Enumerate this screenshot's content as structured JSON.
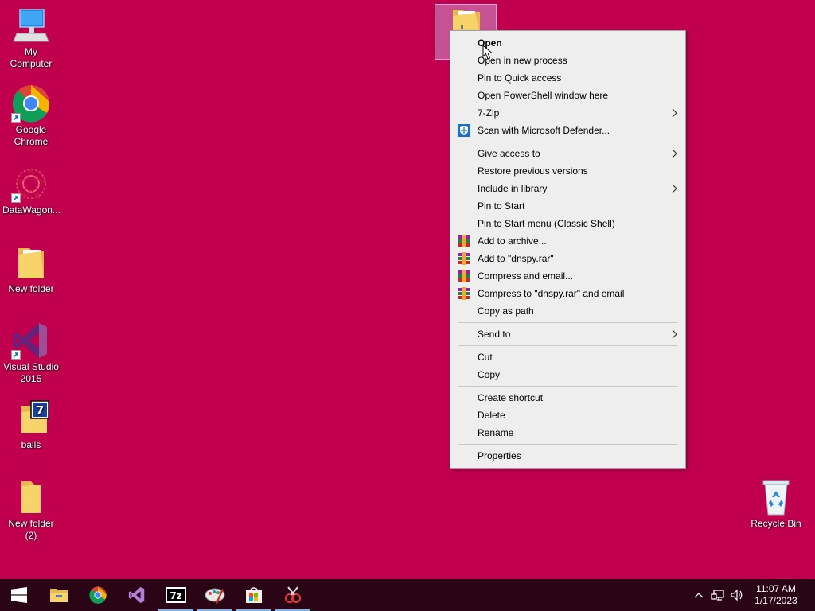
{
  "desktop": {
    "background": "#c0004f",
    "icons": [
      {
        "label": "My Computer",
        "icon": "computer-icon"
      },
      {
        "label": "Google\nChrome",
        "icon": "chrome-icon"
      },
      {
        "label": "DataWagon...",
        "icon": "datawagon-icon"
      },
      {
        "label": "New folder",
        "icon": "folder-icon"
      },
      {
        "label": "Visual Studio\n2015",
        "icon": "visual-studio-icon"
      },
      {
        "label": "balls",
        "icon": "7zip-folder-icon"
      },
      {
        "label": "New folder\n(2)",
        "icon": "folder-icon"
      },
      {
        "label": "Recycle Bin",
        "icon": "recycle-bin-icon"
      }
    ]
  },
  "context_menu": {
    "items": [
      {
        "label": "Open",
        "bold": true
      },
      {
        "label": "Open in new process"
      },
      {
        "label": "Pin to Quick access"
      },
      {
        "label": "Open PowerShell window here"
      },
      {
        "label": "7-Zip",
        "submenu": true
      },
      {
        "label": "Scan with Microsoft Defender...",
        "icon": "defender-icon"
      },
      {
        "label": "Give access to",
        "submenu": true
      },
      {
        "label": "Restore previous versions"
      },
      {
        "label": "Include in library",
        "submenu": true
      },
      {
        "label": "Pin to Start"
      },
      {
        "label": "Pin to Start menu (Classic Shell)"
      },
      {
        "label": "Add to archive...",
        "icon": "winrar-icon"
      },
      {
        "label": "Add to \"dnspy.rar\"",
        "icon": "winrar-icon"
      },
      {
        "label": "Compress and email...",
        "icon": "winrar-icon"
      },
      {
        "label": "Compress to \"dnspy.rar\" and email",
        "icon": "winrar-icon"
      },
      {
        "label": "Copy as path"
      },
      {
        "label": "Send to",
        "submenu": true
      },
      {
        "label": "Cut"
      },
      {
        "label": "Copy"
      },
      {
        "label": "Create shortcut"
      },
      {
        "label": "Delete"
      },
      {
        "label": "Rename"
      },
      {
        "label": "Properties"
      }
    ]
  },
  "taskbar": {
    "buttons": [
      {
        "icon": "windows-start-icon"
      },
      {
        "icon": "file-explorer-icon"
      },
      {
        "icon": "chrome-icon"
      },
      {
        "icon": "visual-studio-icon"
      },
      {
        "icon": "7zip-icon"
      },
      {
        "icon": "paint-icon"
      },
      {
        "icon": "store-icon"
      },
      {
        "icon": "dnspy-icon"
      }
    ],
    "tray": {
      "icons": [
        "chevron-up-icon",
        "network-icon",
        "volume-icon"
      ],
      "time": "11:07 AM",
      "date": "1/17/2023"
    }
  }
}
